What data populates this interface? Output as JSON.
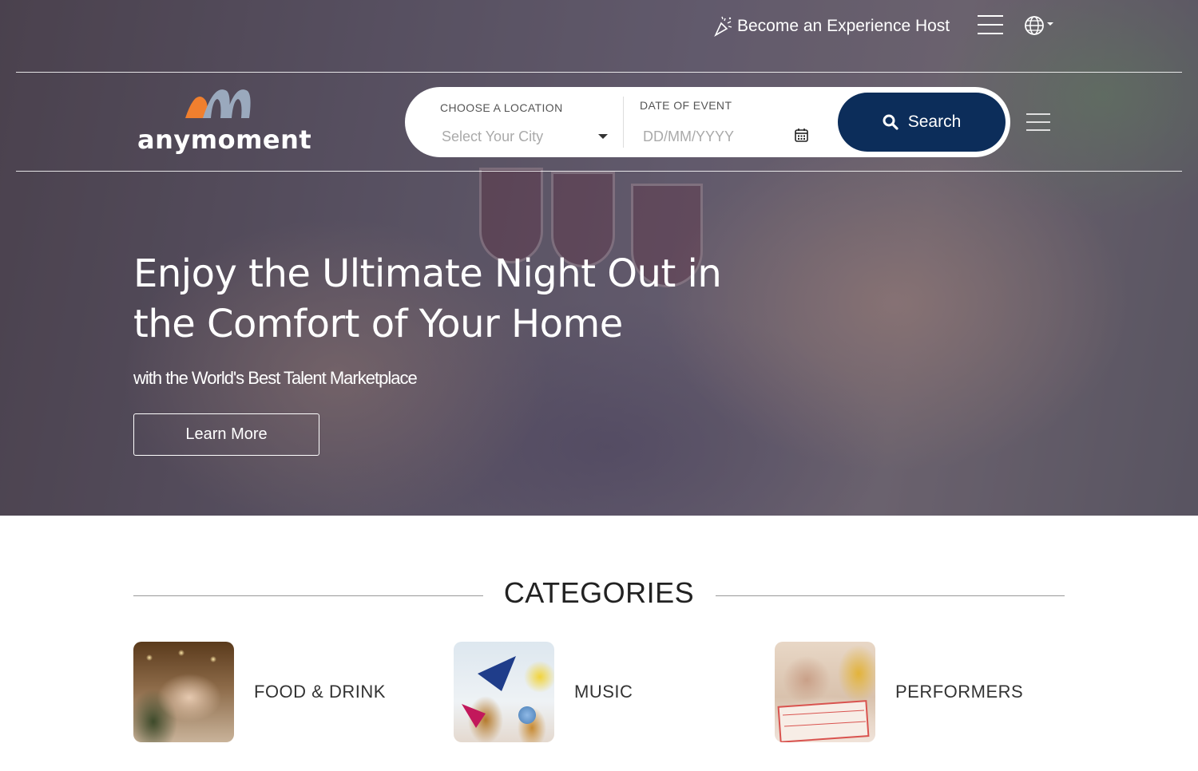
{
  "header": {
    "host_link": "Become an Experience Host"
  },
  "brand": {
    "name": "anymoment",
    "accent_color": "#f07f2e",
    "mark_color": "#9aa9bd"
  },
  "search": {
    "location_label": "CHOOSE A LOCATION",
    "location_placeholder": "Select Your City",
    "date_label": "DATE OF EVENT",
    "date_placeholder": "DD/MM/YYYY",
    "button_label": "Search",
    "button_color": "#0c2d5a"
  },
  "hero": {
    "title_line1": "Enjoy the Ultimate Night Out in",
    "title_line2": "the Comfort of Your Home",
    "subtitle": "with the World's Best Talent Marketplace",
    "cta_label": "Learn More"
  },
  "categories": {
    "title": "CATEGORIES",
    "items": [
      {
        "label": "FOOD & DRINK"
      },
      {
        "label": "MUSIC"
      },
      {
        "label": "PERFORMERS"
      }
    ]
  }
}
